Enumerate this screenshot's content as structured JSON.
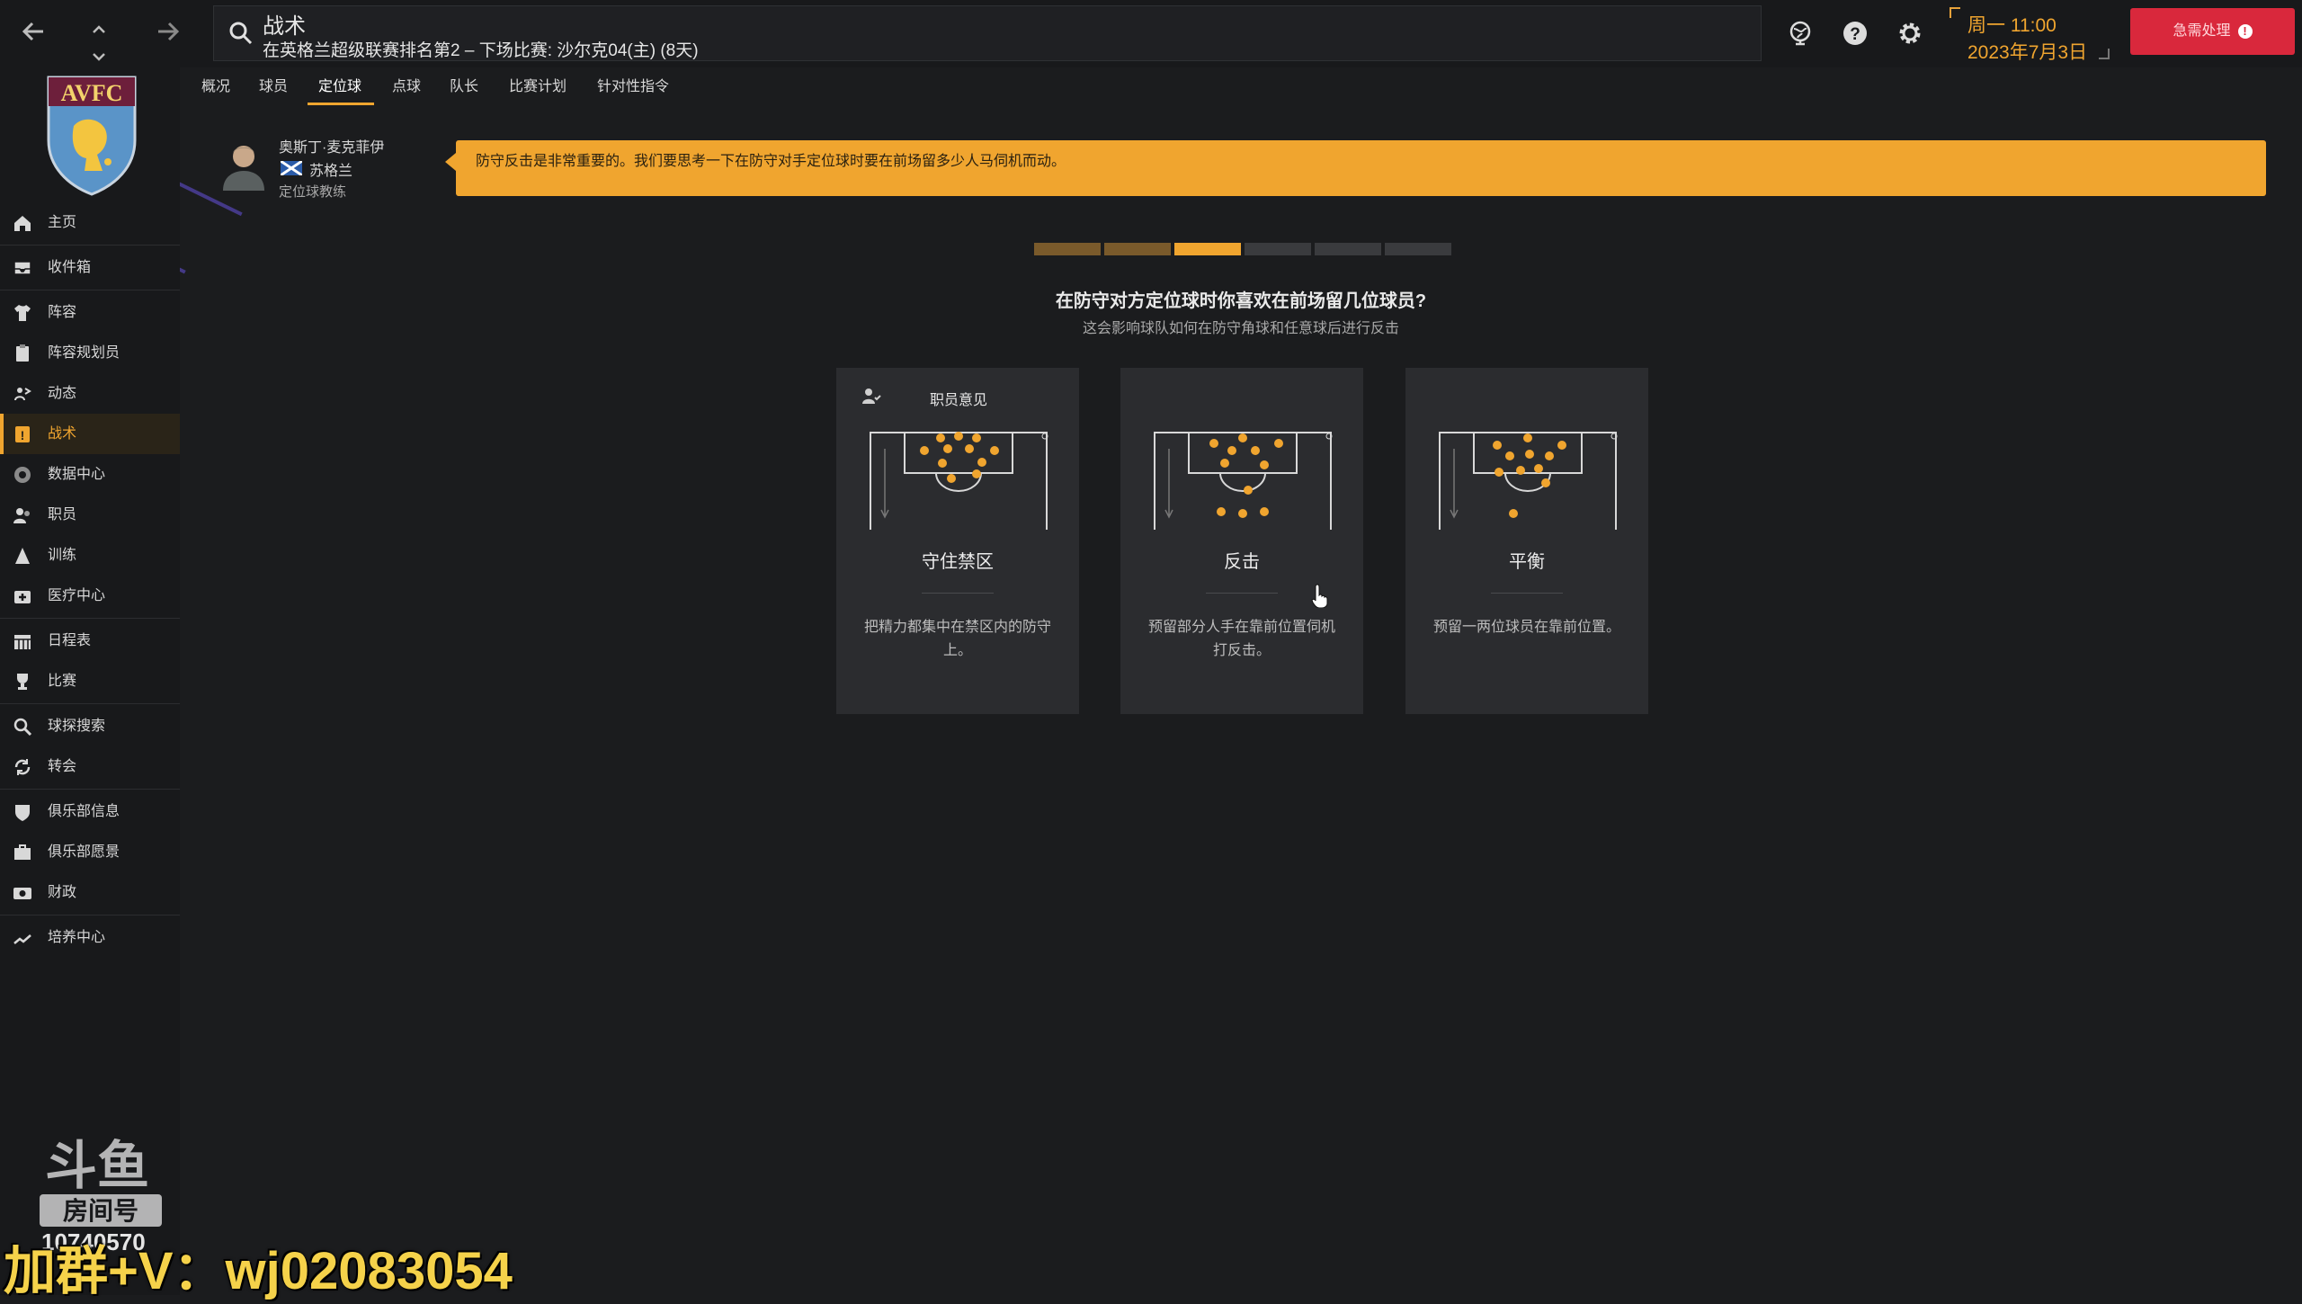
{
  "topbar": {
    "back_icon": "arrow-left-icon",
    "up_icon": "chevron-up-icon",
    "down_icon": "chevron-down-icon",
    "forward_icon": "arrow-right-icon",
    "search_title": "战术",
    "search_subtitle": "在英格兰超级联赛排名第2 – 下场比赛: 沙尔克04(主) (8天)",
    "date_line1": "周一 11:00",
    "date_line2": "2023年7月3日",
    "urgent_label": "急需处理",
    "urgent_badge": "!"
  },
  "sidebar": {
    "crest_text": "AVFC",
    "items": [
      {
        "label": "主页",
        "icon": "home-icon"
      },
      {
        "label": "收件箱",
        "icon": "inbox-icon"
      },
      {
        "label": "阵容",
        "icon": "shirt-icon"
      },
      {
        "label": "阵容规划员",
        "icon": "clipboard-icon"
      },
      {
        "label": "动态",
        "icon": "dynamics-icon"
      },
      {
        "label": "战术",
        "icon": "tactics-icon"
      },
      {
        "label": "数据中心",
        "icon": "data-hub-icon"
      },
      {
        "label": "职员",
        "icon": "staff-icon"
      },
      {
        "label": "训练",
        "icon": "training-icon"
      },
      {
        "label": "医疗中心",
        "icon": "medical-icon"
      },
      {
        "label": "日程表",
        "icon": "calendar-icon"
      },
      {
        "label": "比赛",
        "icon": "trophy-icon"
      },
      {
        "label": "球探搜索",
        "icon": "scouting-icon"
      },
      {
        "label": "转会",
        "icon": "transfer-icon"
      },
      {
        "label": "俱乐部信息",
        "icon": "shield-icon"
      },
      {
        "label": "俱乐部愿景",
        "icon": "vision-icon"
      },
      {
        "label": "财政",
        "icon": "finance-icon"
      },
      {
        "label": "培养中心",
        "icon": "development-icon"
      }
    ]
  },
  "tabs": [
    "概况",
    "球员",
    "定位球",
    "点球",
    "队长",
    "比赛计划",
    "针对性指令"
  ],
  "coach": {
    "name": "奥斯丁·麦克菲伊",
    "nation": "苏格兰",
    "role": "定位球教练"
  },
  "advice": "防守反击是非常重要的。我们要思考一下在防守对手定位球时要在前场留多少人马伺机而动。",
  "progress": {
    "total_steps": 6,
    "current_step": 3
  },
  "question": {
    "title": "在防守对方定位球时你喜欢在前场留几位球员?",
    "subtitle": "这会影响球队如何在防守角球和任意球后进行反击"
  },
  "options": [
    {
      "badge": "职员意见",
      "title": "守住禁区",
      "desc": "把精力都集中在禁区内的防守上。"
    },
    {
      "badge": "",
      "title": "反击",
      "desc": "预留部分人手在靠前位置伺机打反击。"
    },
    {
      "badge": "",
      "title": "平衡",
      "desc": "预留一两位球员在靠前位置。"
    }
  ],
  "watermark": {
    "room_number": "10740570",
    "overlay": "加群+V：wj02083054"
  },
  "colors": {
    "accent": "#f0a52f",
    "urgent": "#d9283c",
    "background": "#1b1c1e"
  }
}
